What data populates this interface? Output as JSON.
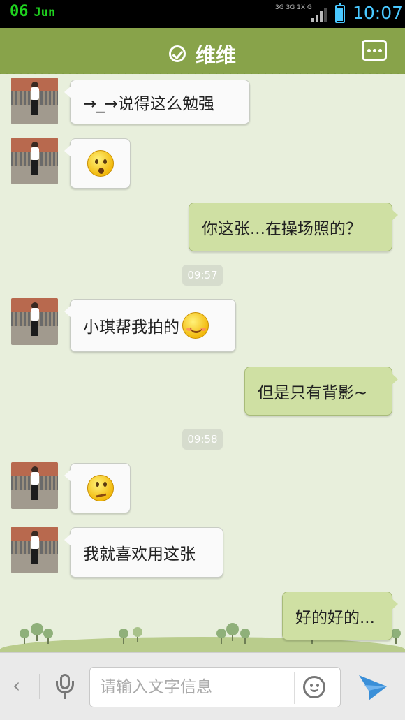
{
  "status_bar": {
    "date_day": "06",
    "date_month": "Jun",
    "network_top": "3G 3G 1X G",
    "time": "10:07",
    "battery_level": 0.85,
    "signal_bars": 3
  },
  "header": {
    "title": "维维",
    "verified_icon": "check-circle-icon",
    "menu_icon": "more-dots-icon"
  },
  "messages": [
    {
      "side": "left",
      "text": "→_→说得这么勉强"
    },
    {
      "side": "left",
      "emoji": "surprised-emoji-icon"
    },
    {
      "side": "right",
      "text": "你这张...在操场照的？"
    },
    {
      "timestamp": "09:57"
    },
    {
      "side": "left",
      "text": "小琪帮我拍的",
      "emoji": "blush-smile-emoji-icon"
    },
    {
      "side": "right",
      "text": "但是只有背影~"
    },
    {
      "timestamp": "09:58"
    },
    {
      "side": "left",
      "emoji": "doubt-emoji-icon"
    },
    {
      "side": "left",
      "text": "我就喜欢用这张"
    },
    {
      "side": "right",
      "text": "好的好的..."
    }
  ],
  "input_bar": {
    "back_label": "‹",
    "placeholder": "请输入文字信息",
    "value": ""
  },
  "colors": {
    "header": "#88a34a",
    "chat_bg": "#e8efdc",
    "right_bubble": "#cfe0a3",
    "left_bubble": "#fafafa",
    "clock": "#4ac8ff",
    "date": "#1fd31f",
    "send": "#3a8fd8"
  }
}
